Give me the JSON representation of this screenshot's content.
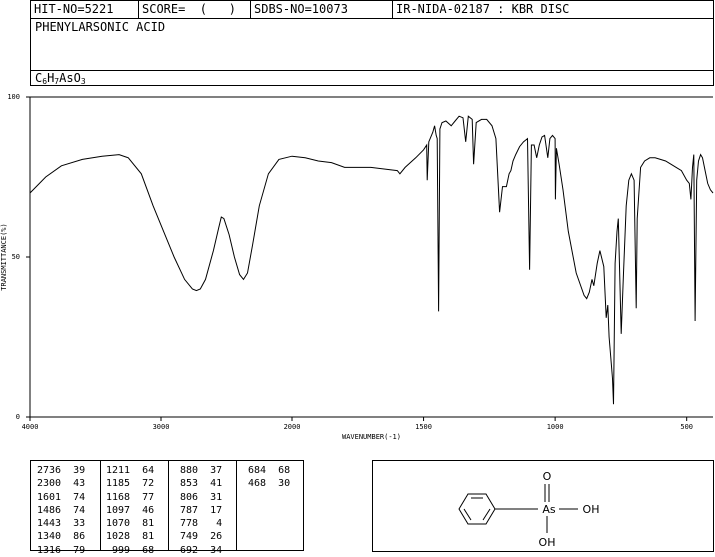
{
  "header": {
    "hit_no": "HIT-NO=5221",
    "score": "SCORE=  (   )",
    "sdbs_no": "SDBS-NO=10073",
    "ir": "IR-NIDA-02187 : KBR DISC",
    "name": "PHENYLARSONIC ACID",
    "formula": {
      "c": "C",
      "c_n": "6",
      "h": "H",
      "h_n": "7",
      "as": "AsO",
      "o_n": "3"
    }
  },
  "chart_data": {
    "type": "line",
    "title": "",
    "xlabel": "WAVENUMBER(-1)",
    "ylabel": "TRANSMITTANCE(%)",
    "xlim": [
      4000,
      400
    ],
    "ylim": [
      0,
      100
    ],
    "x_ticks": [
      4000,
      3000,
      2000,
      1500,
      1000,
      500
    ],
    "y_ticks": [
      0,
      50,
      100
    ],
    "x_tick_labels": [
      "4000",
      "3000",
      "2000",
      "1500",
      "1000",
      "500"
    ],
    "y_tick_labels": [
      "0",
      "50",
      "100"
    ],
    "axis_scale": "wavenumber axis: 4000-2000 and 2000-400 at doubled density",
    "series": [
      {
        "points": [
          [
            4000,
            70
          ],
          [
            3880,
            75
          ],
          [
            3760,
            78.5
          ],
          [
            3600,
            80.5
          ],
          [
            3450,
            81.5
          ],
          [
            3320,
            82
          ],
          [
            3250,
            81
          ],
          [
            3150,
            76
          ],
          [
            3060,
            66
          ],
          [
            2980,
            58
          ],
          [
            2900,
            50
          ],
          [
            2820,
            43
          ],
          [
            2760,
            40
          ],
          [
            2730,
            39.5
          ],
          [
            2700,
            40
          ],
          [
            2660,
            43
          ],
          [
            2600,
            52
          ],
          [
            2560,
            59
          ],
          [
            2540,
            62.5
          ],
          [
            2520,
            62
          ],
          [
            2480,
            57
          ],
          [
            2440,
            50
          ],
          [
            2400,
            44.5
          ],
          [
            2370,
            43
          ],
          [
            2340,
            45
          ],
          [
            2300,
            54
          ],
          [
            2250,
            66
          ],
          [
            2180,
            76
          ],
          [
            2100,
            80.5
          ],
          [
            2000,
            81.5
          ],
          [
            1950,
            81
          ],
          [
            1900,
            80
          ],
          [
            1850,
            79.5
          ],
          [
            1800,
            78
          ],
          [
            1750,
            78
          ],
          [
            1700,
            78
          ],
          [
            1650,
            77.5
          ],
          [
            1600,
            77
          ],
          [
            1590,
            76
          ],
          [
            1570,
            78
          ],
          [
            1530,
            81
          ],
          [
            1500,
            83.5
          ],
          [
            1488,
            85
          ],
          [
            1486,
            74
          ],
          [
            1480,
            86
          ],
          [
            1465,
            89
          ],
          [
            1458,
            91
          ],
          [
            1452,
            88
          ],
          [
            1448,
            87
          ],
          [
            1443,
            33
          ],
          [
            1438,
            90
          ],
          [
            1430,
            92
          ],
          [
            1415,
            92.5
          ],
          [
            1395,
            91
          ],
          [
            1380,
            92.5
          ],
          [
            1365,
            94
          ],
          [
            1350,
            93.5
          ],
          [
            1340,
            86
          ],
          [
            1330,
            94
          ],
          [
            1315,
            93
          ],
          [
            1310,
            79
          ],
          [
            1300,
            92
          ],
          [
            1280,
            93
          ],
          [
            1260,
            93
          ],
          [
            1240,
            91
          ],
          [
            1225,
            87
          ],
          [
            1211,
            64
          ],
          [
            1200,
            72
          ],
          [
            1185,
            72
          ],
          [
            1175,
            76
          ],
          [
            1168,
            77
          ],
          [
            1160,
            80
          ],
          [
            1150,
            82
          ],
          [
            1135,
            84.5
          ],
          [
            1120,
            86
          ],
          [
            1105,
            87
          ],
          [
            1097,
            46
          ],
          [
            1090,
            85
          ],
          [
            1080,
            85
          ],
          [
            1070,
            81
          ],
          [
            1060,
            85
          ],
          [
            1050,
            87.5
          ],
          [
            1040,
            88
          ],
          [
            1028,
            81
          ],
          [
            1020,
            87
          ],
          [
            1010,
            88
          ],
          [
            1000,
            87
          ],
          [
            999,
            68
          ],
          [
            995,
            84
          ],
          [
            985,
            79
          ],
          [
            970,
            71
          ],
          [
            950,
            58
          ],
          [
            920,
            45
          ],
          [
            890,
            38
          ],
          [
            880,
            37
          ],
          [
            870,
            39
          ],
          [
            860,
            43
          ],
          [
            853,
            41
          ],
          [
            840,
            48
          ],
          [
            830,
            52
          ],
          [
            815,
            47
          ],
          [
            806,
            31
          ],
          [
            800,
            35
          ],
          [
            795,
            25
          ],
          [
            787,
            17
          ],
          [
            782,
            12
          ],
          [
            778,
            4
          ],
          [
            772,
            48
          ],
          [
            765,
            58
          ],
          [
            760,
            62
          ],
          [
            749,
            26
          ],
          [
            740,
            45
          ],
          [
            730,
            66
          ],
          [
            720,
            74
          ],
          [
            710,
            76
          ],
          [
            700,
            74
          ],
          [
            692,
            34
          ],
          [
            688,
            62
          ],
          [
            675,
            78
          ],
          [
            660,
            80
          ],
          [
            640,
            81
          ],
          [
            620,
            81
          ],
          [
            600,
            80.5
          ],
          [
            580,
            80
          ],
          [
            560,
            79
          ],
          [
            540,
            78
          ],
          [
            520,
            77
          ],
          [
            500,
            74
          ],
          [
            490,
            73
          ],
          [
            484,
            68
          ],
          [
            478,
            78
          ],
          [
            473,
            82
          ],
          [
            468,
            30
          ],
          [
            462,
            74
          ],
          [
            455,
            80
          ],
          [
            447,
            82
          ],
          [
            440,
            81
          ],
          [
            430,
            77
          ],
          [
            420,
            73
          ],
          [
            410,
            71
          ],
          [
            400,
            70
          ]
        ]
      }
    ],
    "peak_table": [
      {
        "wn": "2736",
        "t": "39"
      },
      {
        "wn": "2300",
        "t": "43"
      },
      {
        "wn": "1601",
        "t": "74"
      },
      {
        "wn": "1486",
        "t": "74"
      },
      {
        "wn": "1443",
        "t": "33"
      },
      {
        "wn": "1340",
        "t": "86"
      },
      {
        "wn": "1316",
        "t": "79"
      },
      {
        "wn": "1211",
        "t": "64"
      },
      {
        "wn": "1185",
        "t": "72"
      },
      {
        "wn": "1168",
        "t": "77"
      },
      {
        "wn": "1097",
        "t": "46"
      },
      {
        "wn": "1070",
        "t": "81"
      },
      {
        "wn": "1028",
        "t": "81"
      },
      {
        "wn": "999",
        "t": "68"
      },
      {
        "wn": "880",
        "t": "37"
      },
      {
        "wn": "853",
        "t": "41"
      },
      {
        "wn": "806",
        "t": "31"
      },
      {
        "wn": "787",
        "t": "17"
      },
      {
        "wn": "778",
        "t": "4"
      },
      {
        "wn": "749",
        "t": "26"
      },
      {
        "wn": "692",
        "t": "34"
      },
      {
        "wn": "684",
        "t": "68"
      },
      {
        "wn": "468",
        "t": "30"
      }
    ]
  },
  "structure": {
    "o_top": "O",
    "as": "As",
    "oh_right": "OH",
    "oh_bottom": "OH"
  }
}
